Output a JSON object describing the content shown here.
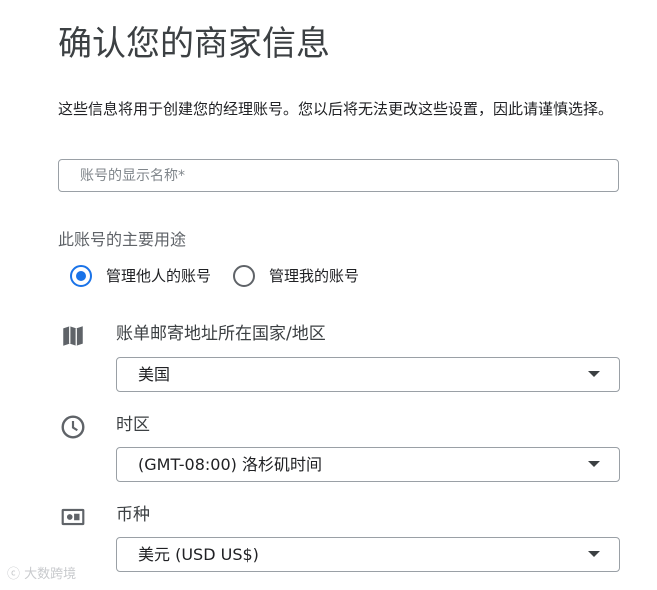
{
  "header": {
    "title": "确认您的商家信息",
    "description": "这些信息将用于创建您的经理账号。您以后将无法更改这些设置，因此请谨慎选择。"
  },
  "display_name_field": {
    "placeholder": "账号的显示名称*",
    "value": ""
  },
  "usage": {
    "label": "此账号的主要用途",
    "options": [
      {
        "label": "管理他人的账号",
        "selected": true
      },
      {
        "label": "管理我的账号",
        "selected": false
      }
    ]
  },
  "country_field": {
    "icon": "map-icon",
    "label": "账单邮寄地址所在国家/地区",
    "value": "美国"
  },
  "timezone_field": {
    "icon": "clock-icon",
    "label": "时区",
    "value": "(GMT-08:00) 洛杉矶时间"
  },
  "currency_field": {
    "icon": "currency-icon",
    "label": "币种",
    "value": "美元 (USD US$)"
  },
  "colors": {
    "accent": "#1a73e8",
    "text": "#202124",
    "secondary_text": "#5f6368",
    "border": "#9aa0a6",
    "icon": "#5f6368"
  }
}
